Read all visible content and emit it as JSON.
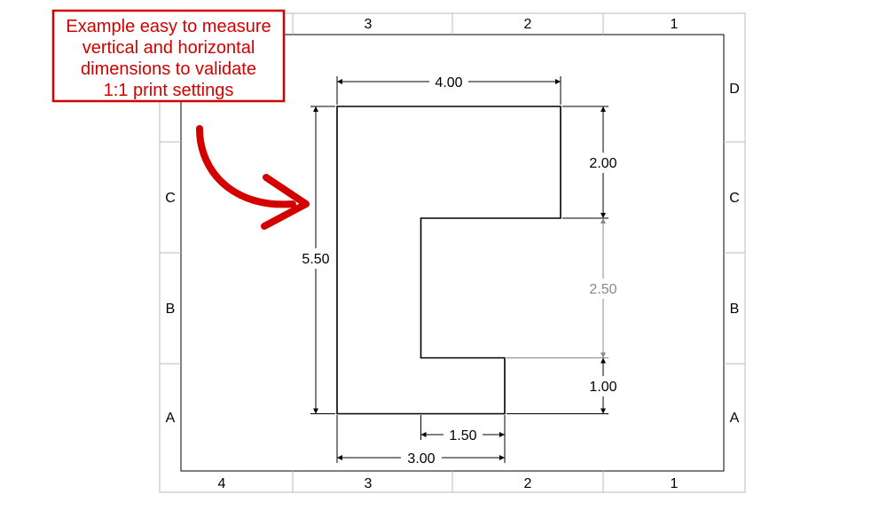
{
  "callout": {
    "line1": "Example easy to measure",
    "line2": "vertical and horizontal",
    "line3": "dimensions to validate",
    "line4": "1:1 print settings"
  },
  "zones": {
    "columns": [
      "4",
      "3",
      "2",
      "1"
    ],
    "rows": [
      "D",
      "C",
      "B",
      "A"
    ]
  },
  "dimensions": {
    "d4_00": "4.00",
    "d2_00": "2.00",
    "d5_50": "5.50",
    "d2_50": "2.50",
    "d1_00": "1.00",
    "d1_50": "1.50",
    "d3_00": "3.00"
  },
  "chart_data": {
    "type": "diagram",
    "title": "Example easy to measure vertical and horizontal dimensions to validate 1:1 print settings",
    "frame_zones": {
      "columns": [
        "4",
        "3",
        "2",
        "1"
      ],
      "rows_top_to_bottom": [
        "D",
        "C",
        "B",
        "A"
      ]
    },
    "part_profile": {
      "units": "in",
      "description": "Flat profile, C-like shape open to the right with a bottom step",
      "dimensions": {
        "overall_height": 5.5,
        "top_width": 4.0,
        "top_right_drop": 2.0,
        "middle_notch_height": 2.5,
        "bottom_step_height": 1.0,
        "bottom_step_width_from_left_offset": 1.5,
        "bottom_overall_width": 3.0
      },
      "vertices_xy_from_top_left": [
        [
          0.0,
          0.0
        ],
        [
          4.0,
          0.0
        ],
        [
          4.0,
          2.0
        ],
        [
          1.5,
          2.0
        ],
        [
          1.5,
          4.5
        ],
        [
          3.0,
          4.5
        ],
        [
          3.0,
          5.5
        ],
        [
          0.0,
          5.5
        ]
      ]
    }
  }
}
